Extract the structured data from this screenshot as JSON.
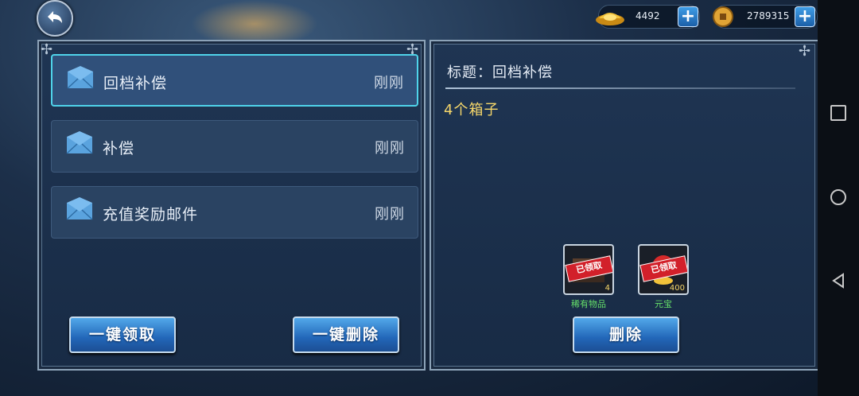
{
  "currencies": {
    "gold_ingot": {
      "icon": "gold-ingot-icon",
      "value": "4492"
    },
    "copper_coin": {
      "icon": "copper-coin-icon",
      "value": "2789315"
    },
    "plus_label": "+"
  },
  "mail_list": [
    {
      "title": "回档补偿",
      "time": "刚刚",
      "selected": true
    },
    {
      "title": "补偿",
      "time": "刚刚",
      "selected": false
    },
    {
      "title": "充值奖励邮件",
      "time": "刚刚",
      "selected": false
    }
  ],
  "left_actions": {
    "claim_all": "一键领取",
    "delete_all": "一键删除"
  },
  "detail": {
    "subject": "标题：回档补偿",
    "body": "4个箱子",
    "rewards": [
      {
        "name": "稀有物品",
        "qty": "4",
        "stamp": "已领取"
      },
      {
        "name": "元宝",
        "qty": "400",
        "stamp": "已领取"
      }
    ],
    "delete_label": "删除"
  },
  "colors": {
    "accent_selected": "#4fd3ea",
    "body_text": "#f5d66a",
    "reward_name": "#66e06a",
    "stamp_red": "#d2202a"
  }
}
